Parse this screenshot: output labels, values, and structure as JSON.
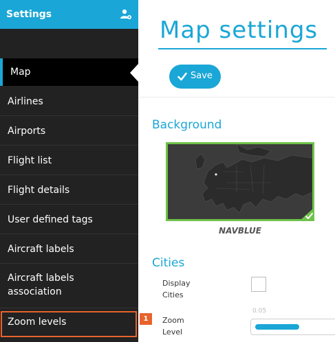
{
  "colors": {
    "accent": "#1aa6d6",
    "sidebar_bg": "#222222",
    "highlight": "#e8632c",
    "selected_border": "#6fc24a"
  },
  "sidebar": {
    "title": "Settings",
    "items": [
      {
        "label": "Map",
        "active": true
      },
      {
        "label": "Airlines"
      },
      {
        "label": "Airports"
      },
      {
        "label": "Flight list"
      },
      {
        "label": "Flight details"
      },
      {
        "label": "User defined tags"
      },
      {
        "label": "Aircraft labels"
      },
      {
        "label": "Aircraft labels association"
      },
      {
        "label": "Zoom levels",
        "highlighted": true
      }
    ],
    "badge": "1"
  },
  "main": {
    "title": "Map settings",
    "save_label": "Save",
    "background": {
      "heading": "Background",
      "selected_map": "NAVBLUE"
    },
    "cities": {
      "heading": "Cities",
      "display_label": "Display Cities",
      "zoom_label": "Zoom Level",
      "zoom_min": "0.05",
      "zoom_value_fraction": 0.55
    }
  }
}
